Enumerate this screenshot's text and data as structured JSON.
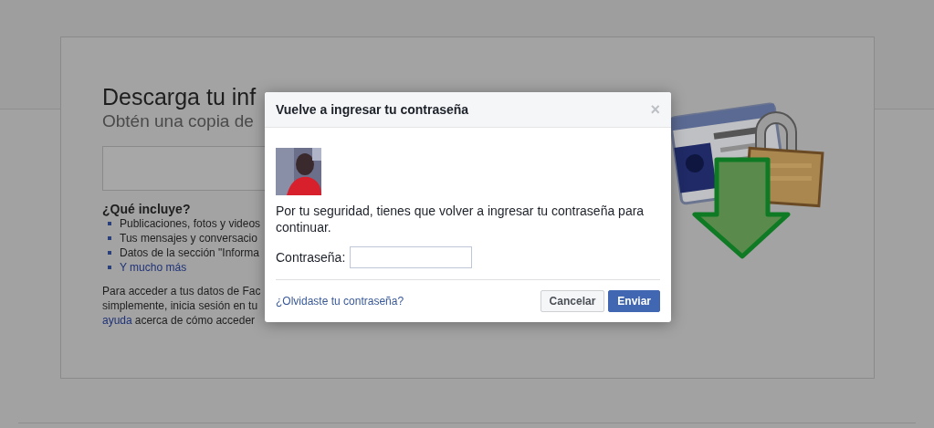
{
  "page": {
    "heading": "Descarga tu inf",
    "subheading": "Obtén una copia de",
    "section_title": "¿Qué incluye?",
    "items": [
      {
        "text": "Publicaciones, fotos y videos",
        "kind": "text"
      },
      {
        "text": "Tus mensajes y conversacio",
        "kind": "text"
      },
      {
        "text": "Datos de la sección \"Informa",
        "kind": "text"
      },
      {
        "text": "Y mucho más",
        "kind": "link"
      }
    ],
    "paragraph": [
      {
        "parts": [
          {
            "text": "Para acceder a tus datos de Fac",
            "kind": "text"
          }
        ]
      },
      {
        "parts": [
          {
            "text": "simplemente, inicia sesión en tu",
            "kind": "text"
          }
        ]
      },
      {
        "parts": [
          {
            "text": "ayuda",
            "kind": "link"
          },
          {
            "text": "acerca de cómo acceder",
            "kind": "text"
          }
        ]
      }
    ]
  },
  "modal": {
    "title": "Vuelve a ingresar tu contraseña",
    "close": "×",
    "message": "Por tu seguridad, tienes que volver a ingresar tu contraseña para continuar.",
    "password_label": "Contraseña:",
    "forgot_link": "¿Olvidaste tu contraseña?",
    "buttons": [
      {
        "label": "Cancelar",
        "kind": "secondary"
      },
      {
        "label": "Enviar",
        "kind": "primary"
      }
    ]
  }
}
